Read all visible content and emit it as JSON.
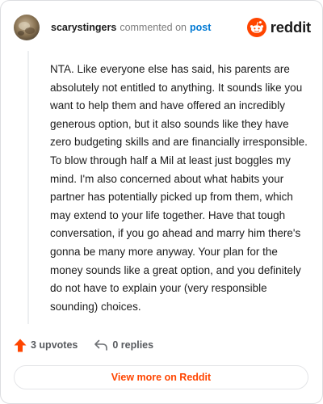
{
  "header": {
    "username": "scarystingers",
    "action_text": "commented on",
    "post_link": "post",
    "brand": "reddit"
  },
  "comment": {
    "body": "NTA. Like everyone else has said, his parents are absolutely not entitled to anything. It sounds like you want to help them and have offered an incredibly generous option, but it also sounds like they have zero budgeting skills and are financially irresponsible. To blow through half a Mil at least just boggles my mind. I'm also concerned about what habits your partner has potentially picked up from them, which may extend to your life together. Have that tough conversation, if you go ahead and marry him there's gonna be many more anyway. Your plan for the money sounds like a great option, and you definitely do not have to explain your (very responsible sounding) choices."
  },
  "actions": {
    "upvotes_label": "3 upvotes",
    "replies_label": "0 replies",
    "upvote_icon": "upvote-arrow-icon",
    "reply_icon": "reply-arrow-icon"
  },
  "footer": {
    "view_more_label": "View more on Reddit"
  },
  "colors": {
    "brand_orange": "#ff4500",
    "link_blue": "#0079d3",
    "text_dark": "#1c1c1c",
    "text_muted": "#7c7c7c"
  }
}
